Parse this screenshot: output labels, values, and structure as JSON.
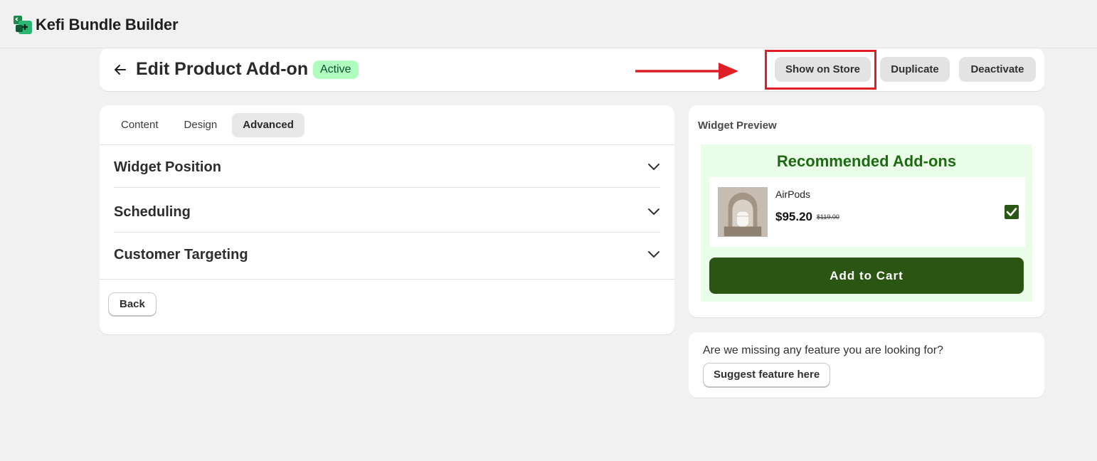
{
  "app": {
    "title": "Kefi Bundle Builder"
  },
  "header": {
    "title": "Edit Product Add-on",
    "status": "Active",
    "buttons": {
      "show_on_store": "Show on Store",
      "duplicate": "Duplicate",
      "deactivate": "Deactivate"
    }
  },
  "tabs": [
    {
      "label": "Content",
      "active": false
    },
    {
      "label": "Design",
      "active": false
    },
    {
      "label": "Advanced",
      "active": true
    }
  ],
  "accordion": [
    {
      "label": "Widget Position"
    },
    {
      "label": "Scheduling"
    },
    {
      "label": "Customer Targeting"
    }
  ],
  "footer": {
    "back_label": "Back"
  },
  "preview": {
    "label": "Widget Preview",
    "widget_title": "Recommended Add-ons",
    "product": {
      "name": "AirPods",
      "price": "$95.20",
      "old_price": "$119.00",
      "checked": true
    },
    "add_to_cart": "Add to Cart"
  },
  "feedback": {
    "question": "Are we missing any feature you are looking for?",
    "button": "Suggest feature here"
  },
  "colors": {
    "badge_bg": "#affebf",
    "widget_bg": "#e9fde9",
    "widget_title": "#1d6a12",
    "cart_button": "#2b5512",
    "annotation": "#e01e26"
  }
}
